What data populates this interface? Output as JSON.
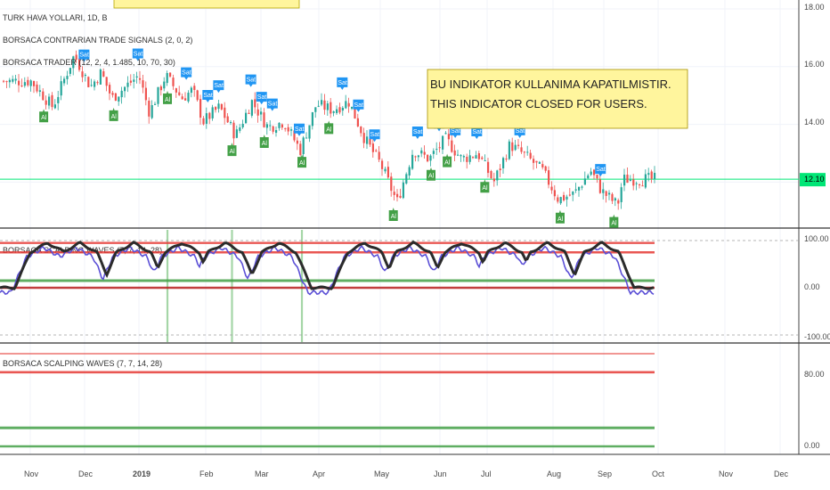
{
  "legend": {
    "symbol": "TURK HAVA YOLLARI, 1D, B",
    "contrarian": "BORSACA CONTRARIAN TRADE SIGNALS (2, 0, 2)",
    "trader": "BORSACA TRADER (12, 2, 4, 1.485, 10, 70, 30)",
    "scalp_pane1": "BORSACA SCALPING WAVES (7, 7, 14, 28)",
    "scalp_pane2": "BORSACA SCALPING WAVES (7, 7, 14, 28)"
  },
  "note": {
    "line1": "BU INDIKATOR KULLANIMA KAPATILMISTIR.",
    "line2": "THIS INDICATOR CLOSED FOR USERS."
  },
  "signal_labels": {
    "sell": "Sat",
    "buy": "Al"
  },
  "colors": {
    "up": "#26a69a",
    "down": "#ef5350",
    "sell_badge": "#2196f3",
    "buy_badge": "#43a047",
    "price_line": "#00e676",
    "note_bg": "#fff59d",
    "osc_blue": "#5b4fd6",
    "osc_black": "#2b2b2b",
    "band_red": "#e53935",
    "band_green": "#43a047",
    "band_darkred": "#b71c1c"
  },
  "chart_data": [
    {
      "type": "candlestick",
      "title": "TURK HAVA YOLLARI, 1D",
      "y_axis_ticks": [
        "18.00",
        "16.00",
        "14.00",
        "12.00"
      ],
      "ylim": [
        10.3,
        18.1
      ],
      "last_price": "12.10",
      "x_months": [
        "Nov",
        "Dec",
        "2019",
        "Feb",
        "Mar",
        "Apr",
        "May",
        "Jun",
        "Jul",
        "Aug",
        "Sep",
        "Oct",
        "Nov",
        "Dec"
      ],
      "close_keypoints": [
        {
          "m": 0,
          "v": 15.5
        },
        {
          "m": 0.4,
          "v": 14.6
        },
        {
          "m": 0.8,
          "v": 16.4
        },
        {
          "m": 1.1,
          "v": 15.3
        },
        {
          "m": 1.3,
          "v": 15.8
        },
        {
          "m": 1.5,
          "v": 14.9
        },
        {
          "m": 2.0,
          "v": 15.7
        },
        {
          "m": 2.2,
          "v": 14.4
        },
        {
          "m": 2.5,
          "v": 15.7
        },
        {
          "m": 2.8,
          "v": 14.9
        },
        {
          "m": 3.0,
          "v": 15.2
        },
        {
          "m": 3.2,
          "v": 14.1
        },
        {
          "m": 3.5,
          "v": 14.6
        },
        {
          "m": 3.8,
          "v": 13.6
        },
        {
          "m": 4.1,
          "v": 14.8
        },
        {
          "m": 4.4,
          "v": 13.9
        },
        {
          "m": 4.7,
          "v": 14.1
        },
        {
          "m": 5.0,
          "v": 13.1
        },
        {
          "m": 5.3,
          "v": 14.7
        },
        {
          "m": 5.6,
          "v": 14.5
        },
        {
          "m": 5.9,
          "v": 14.8
        },
        {
          "m": 6.2,
          "v": 13.5
        },
        {
          "m": 6.5,
          "v": 12.6
        },
        {
          "m": 6.8,
          "v": 11.3
        },
        {
          "m": 7.1,
          "v": 13.1
        },
        {
          "m": 7.4,
          "v": 12.8
        },
        {
          "m": 7.7,
          "v": 13.5
        },
        {
          "m": 8.0,
          "v": 12.8
        },
        {
          "m": 8.3,
          "v": 13.0
        },
        {
          "m": 8.6,
          "v": 12.0
        },
        {
          "m": 8.9,
          "v": 13.3
        },
        {
          "m": 9.2,
          "v": 12.9
        },
        {
          "m": 9.5,
          "v": 12.4
        },
        {
          "m": 9.8,
          "v": 11.4
        },
        {
          "m": 10.1,
          "v": 11.6
        },
        {
          "m": 10.4,
          "v": 12.4
        },
        {
          "m": 10.6,
          "v": 11.7
        },
        {
          "m": 10.9,
          "v": 11.2
        },
        {
          "m": 11.0,
          "v": 12.1
        }
      ],
      "sell_signals_m": [
        1.0,
        2.0,
        2.9,
        3.3,
        3.5,
        4.1,
        4.3,
        4.5,
        5.0,
        5.8,
        6.1,
        6.4,
        7.2,
        7.6,
        7.9,
        8.3,
        9.1,
        10.6
      ],
      "buy_signals_m": [
        0.25,
        1.55,
        2.55,
        3.75,
        4.35,
        5.05,
        5.55,
        6.75,
        7.45,
        7.75,
        8.45,
        9.85,
        10.85
      ]
    },
    {
      "type": "line",
      "title": "BORSACA SCALPING WAVES (7, 7, 14, 28)",
      "y_axis_ticks": [
        "100.00",
        "0.00",
        "-100.00"
      ],
      "ylim": [
        -110,
        110
      ],
      "bands": [
        95,
        75,
        15,
        0
      ],
      "series": [
        {
          "name": "fast",
          "color": "blue",
          "peaks_m": [
            0.3,
            0.9,
            1.9,
            2.8,
            3.6,
            4.6,
            6.2,
            7.1,
            8.0,
            8.8,
            9.6,
            10.6
          ]
        },
        {
          "name": "slow",
          "color": "black",
          "peaks_m": [
            0.3,
            0.9,
            1.9,
            2.8,
            3.6,
            4.6,
            6.2,
            7.1,
            8.0,
            8.8,
            9.6,
            10.6
          ]
        }
      ],
      "vertical_marks_m": [
        2.55,
        3.75,
        5.05
      ]
    },
    {
      "type": "line",
      "title": "BORSACA SCALPING WAVES (7, 7, 14, 28)",
      "y_axis_ticks": [
        "80.00",
        "0.00"
      ],
      "ylim": [
        -5,
        110
      ],
      "bands": [
        100,
        80,
        20,
        0
      ]
    }
  ]
}
